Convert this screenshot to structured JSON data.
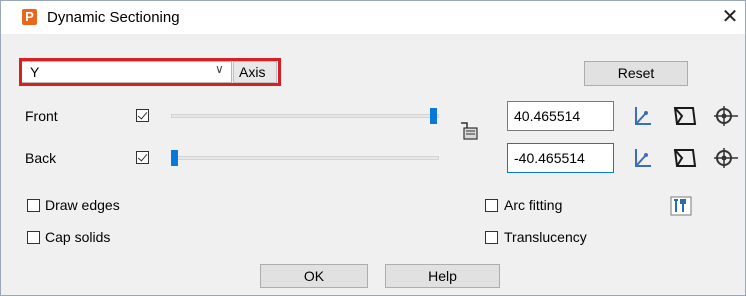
{
  "window": {
    "title": "Dynamic Sectioning",
    "app_icon_letter": "P",
    "close_glyph": "✕"
  },
  "axis": {
    "value": "Y",
    "label": "Axis",
    "chevron": "∨"
  },
  "reset_label": "Reset",
  "front": {
    "label": "Front",
    "checked": true,
    "slider_fraction": 1.0,
    "value": "40.465514"
  },
  "back": {
    "label": "Back",
    "checked": true,
    "slider_fraction": 0.0,
    "value": "-40.465514"
  },
  "options": {
    "draw_edges": "Draw edges",
    "cap_solids": "Cap solids",
    "arc_fitting": "Arc fitting",
    "translucency": "Translucency"
  },
  "buttons": {
    "ok": "OK",
    "help": "Help"
  },
  "icons": {
    "lock": "lock-link-icon",
    "axis": "axis-icon",
    "section_plane": "section-plane-icon",
    "gear_section": "section-settings-icon",
    "tools": "tools-icon"
  },
  "colors": {
    "accent": "#0a78d7",
    "highlight": "#d61f26",
    "app_icon": "#e8671b"
  }
}
